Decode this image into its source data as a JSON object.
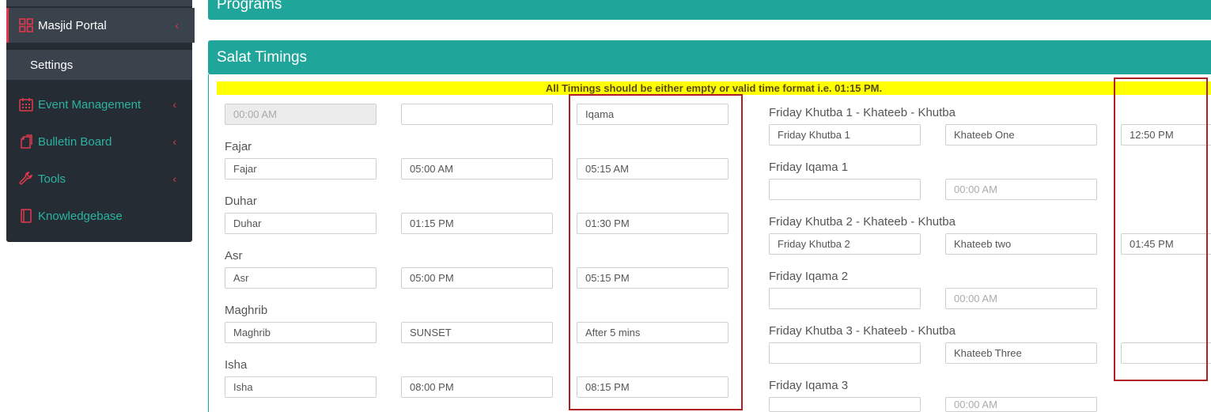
{
  "sidebar": {
    "active": {
      "label": "Masjid Portal",
      "icon": "grid-icon"
    },
    "sub": {
      "label": "Settings"
    },
    "items": [
      {
        "label": "Event Management",
        "icon": "calendar-icon"
      },
      {
        "label": "Bulletin Board",
        "icon": "document-icon"
      },
      {
        "label": "Tools",
        "icon": "wrench-icon"
      },
      {
        "label": "Knowledgebase",
        "icon": "book-icon"
      }
    ],
    "colors": {
      "bg": "#262c34",
      "accent": "#2bb3a0",
      "chevron": "#e0394b"
    }
  },
  "programs": {
    "title": "Programs"
  },
  "salat": {
    "title": "Salat Timings",
    "notice": "All Timings should be either empty or valid time format i.e. 01:15 PM.",
    "header_row": {
      "time_placeholder": "00:00 AM",
      "time": "",
      "col3": "Iqama"
    },
    "prayers": [
      {
        "label": "Fajar",
        "name": "Fajar",
        "adhan": "05:00 AM",
        "iqama": "05:15 AM"
      },
      {
        "label": "Duhar",
        "name": "Duhar",
        "adhan": "01:15 PM",
        "iqama": "01:30 PM"
      },
      {
        "label": "Asr",
        "name": "Asr",
        "adhan": "05:00 PM",
        "iqama": "05:15 PM"
      },
      {
        "label": "Maghrib",
        "name": "Maghrib",
        "adhan": "SUNSET",
        "iqama": "After 5 mins"
      },
      {
        "label": "Isha",
        "name": "Isha",
        "adhan": "08:00 PM",
        "iqama": "08:15 PM"
      }
    ],
    "friday": [
      {
        "label": "Friday Khutba 1 - Khateeb - Khutba",
        "name": "Friday Khutba 1",
        "khateeb": "Khateeb One",
        "time": "12:50 PM"
      },
      {
        "label": "Friday Iqama 1",
        "name": "",
        "time_placeholder": "00:00 AM"
      },
      {
        "label": "Friday Khutba 2 - Khateeb - Khutba",
        "name": "Friday Khutba 2",
        "khateeb": "Khateeb two",
        "time": "01:45 PM"
      },
      {
        "label": "Friday Iqama 2",
        "name": "",
        "time_placeholder": "00:00 AM"
      },
      {
        "label": "Friday Khutba 3 - Khateeb - Khutba",
        "name": "",
        "khateeb": "Khateeb Three",
        "time": ""
      },
      {
        "label": "Friday Iqama 3",
        "name": "",
        "time_placeholder": "00:00 AM"
      }
    ]
  },
  "colors": {
    "teal": "#20a59a",
    "notice_bg": "#ffff00",
    "highlight": "#b01f24"
  }
}
